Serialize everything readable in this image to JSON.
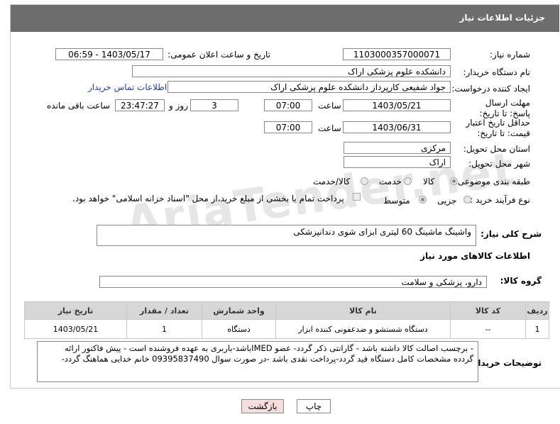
{
  "header": {
    "title": "جزئیات اطلاعات نیاز"
  },
  "form": {
    "need_number_label": "شماره نیاز:",
    "need_number": "1103000357000071",
    "announce_label": "تاریخ و ساعت اعلان عمومی:",
    "announce_value": "1403/05/17 - 06:59",
    "buyer_label": "نام دستگاه خریدار:",
    "buyer_value": "دانشکده علوم پزشکی اراک",
    "creator_label": "ایجاد کننده درخواست:",
    "creator_value": "جواد شفیعی کارپرداز دانشکده علوم پزشکی اراک",
    "contact_link": "اطلاعات تماس خریدار",
    "deadline_label": "مهلت ارسال پاسخ: تا تاریخ:",
    "deadline_date": "1403/05/21",
    "time_label": "ساعت",
    "deadline_time": "07:00",
    "days_value": "3",
    "days_label": "روز و",
    "remaining_time": "23:47:27",
    "remaining_label": "ساعت باقی مانده",
    "validity_label": "حداقل تاریخ اعتبار قیمت: تا تاریخ:",
    "validity_date": "1403/06/31",
    "validity_time": "07:00",
    "province_label": "استان محل تحویل:",
    "province_value": "مرکزی",
    "city_label": "شهر محل تحویل:",
    "city_value": "اراک",
    "category_label": "طبقه بندی موضوعی:",
    "category_options": [
      "کالا",
      "خدمت",
      "کالا/خدمت"
    ],
    "category_selected": "کالا",
    "process_label": "نوع فرآیند خرید :",
    "process_options": [
      "جزیی",
      "متوسط"
    ],
    "process_selected": "متوسط",
    "payment_note": "پرداخت تمام یا بخشی از مبلغ خرید،از محل \"اسناد خزانه اسلامی\" خواهد بود."
  },
  "general_desc": {
    "label": "شرح کلی نیاز:",
    "value": "واشینگ ماشینگ 60 لیتری ابزای شوی دندانپزشکی"
  },
  "goods_section": {
    "title": "اطلاعات کالاهای مورد نیاز",
    "group_label": "گروه کالا:",
    "group_value": "دارو، پزشکی و سلامت"
  },
  "table": {
    "headers": [
      "ردیف",
      "کد کالا",
      "نام کالا",
      "واحد شمارش",
      "تعداد / مقدار",
      "تاریخ نیاز"
    ],
    "rows": [
      [
        "1",
        "--",
        "دستگاه شستشو و ضدعفونی کننده ابزار",
        "دستگاه",
        "1",
        "1403/05/21"
      ]
    ]
  },
  "buyer_notes": {
    "label": "توضیحات خریدار:",
    "line1": "- برچسب اصالت کالا داشته باشد - گارانتی ذکر گردد- عضو IMEDباشد-باربری به عهده فروشنده است - پیش فاکتور ارائه",
    "line2": "گردده مشخصات کامل دستگاه قید گردد-پرداخت نقدی باشد -در صورت سوال 09395837490  خانم خدایی هماهنگ گردد-"
  },
  "buttons": {
    "print": "چاپ",
    "back": "بازگشت"
  },
  "watermark": "AriaTender.net",
  "colors": {
    "titlebar": "#6d6d6d",
    "link": "#1a3fb8",
    "back_button": "#f7dede"
  }
}
